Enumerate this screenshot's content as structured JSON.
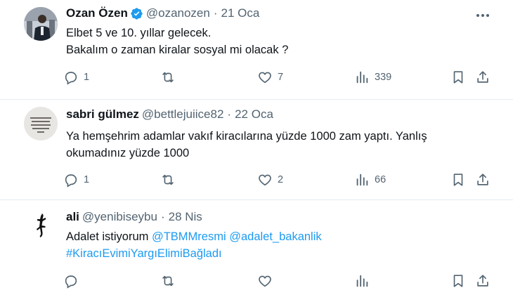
{
  "tweets": [
    {
      "name": "Ozan Özen",
      "verified": true,
      "handle": "@ozanozen",
      "date": "21 Oca",
      "lines": [
        "Elbet 5 ve 10. yıllar gelecek.",
        "Bakalım o zaman kiralar sosyal mi olacak ?"
      ],
      "replies": "1",
      "retweets": "",
      "likes": "7",
      "views": "339"
    },
    {
      "name": "sabri gülmez",
      "verified": false,
      "handle": "@bettlejuiice82",
      "date": "22 Oca",
      "lines": [
        "Ya hemşehrim adamlar vakıf kiracılarına yüzde 1000 zam yaptı. Yanlış",
        "okumadınız yüzde 1000"
      ],
      "replies": "1",
      "retweets": "",
      "likes": "2",
      "views": "66"
    },
    {
      "name": "ali",
      "verified": false,
      "handle": "@yenibiseybu",
      "date": "28 Nis",
      "line1_text": "Adalet istiyorum ",
      "mention1": "@TBMMresmi",
      "mention2": "@adalet_bakanlik",
      "hashtag": "#KiracıEvimiYargıElimiBağladı",
      "replies": "",
      "retweets": "",
      "likes": "",
      "views": ""
    }
  ],
  "colors": {
    "text": "#0f1419",
    "secondary": "#536471",
    "link": "#1d9bf0",
    "verified": "#1d9bf0",
    "divider": "#e6ecf0"
  }
}
